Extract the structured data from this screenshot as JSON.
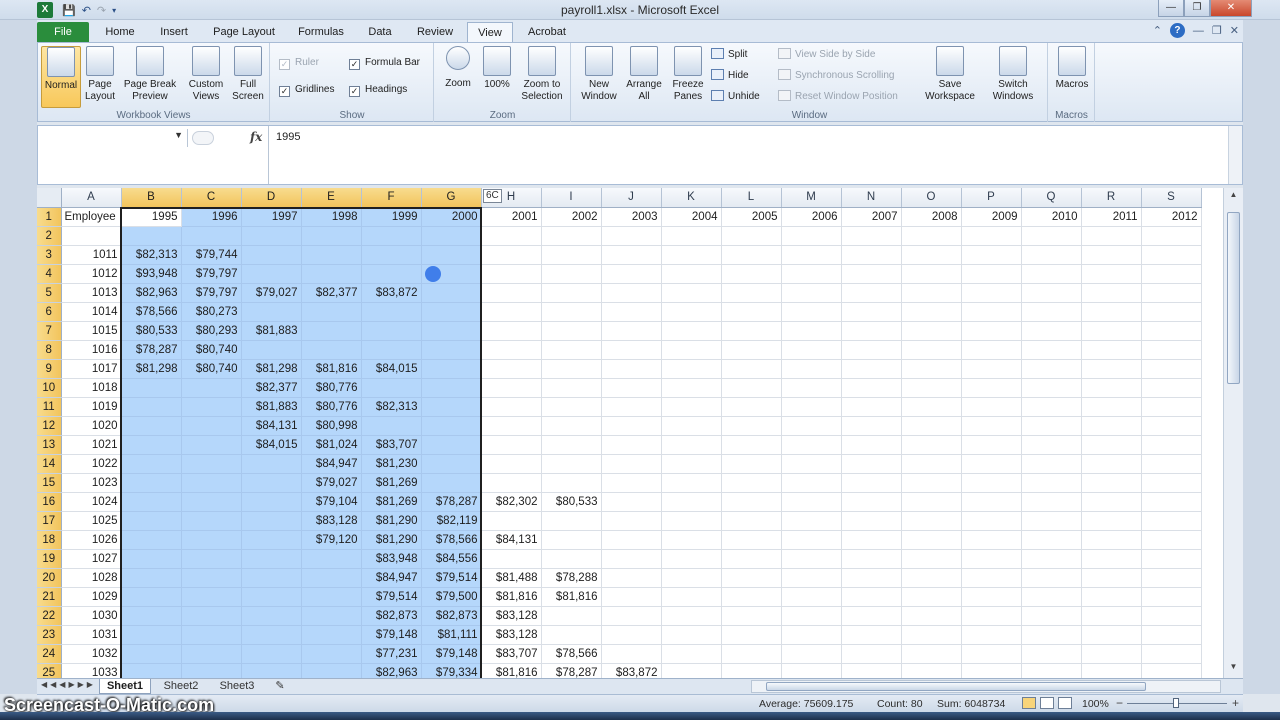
{
  "window": {
    "title": "payroll1.xlsx - Microsoft Excel",
    "app_icon": "X"
  },
  "ribbon_tabs": [
    {
      "label": "File",
      "state": "file"
    },
    {
      "label": "Home"
    },
    {
      "label": "Insert"
    },
    {
      "label": "Page Layout"
    },
    {
      "label": "Formulas"
    },
    {
      "label": "Data"
    },
    {
      "label": "Review"
    },
    {
      "label": "View",
      "state": "active"
    },
    {
      "label": "Acrobat"
    }
  ],
  "ribbon": {
    "workbook_views": {
      "label": "Workbook Views",
      "normal": "Normal",
      "page_layout": "Page Layout",
      "page_break_preview": "Page Break Preview",
      "custom_views": "Custom Views",
      "full_screen": "Full Screen"
    },
    "show": {
      "label": "Show",
      "ruler": "Ruler",
      "formula_bar": "Formula Bar",
      "gridlines": "Gridlines",
      "headings": "Headings"
    },
    "zoom": {
      "label": "Zoom",
      "zoom": "Zoom",
      "hundred": "100%",
      "zoom_to_selection": "Zoom to Selection"
    },
    "window": {
      "label": "Window",
      "new_window": "New Window",
      "arrange_all": "Arrange All",
      "freeze_panes": "Freeze Panes",
      "split": "Split",
      "hide": "Hide",
      "unhide": "Unhide",
      "view_side_by_side": "View Side by Side",
      "synchronous_scrolling": "Synchronous Scrolling",
      "reset_window_position": "Reset Window Position",
      "save_workspace": "Save Workspace",
      "switch_windows": "Switch Windows"
    },
    "macros": {
      "label": "Macros",
      "macros": "Macros"
    }
  },
  "formula_bar": {
    "name_box": "",
    "fx": "fx",
    "value": "1995"
  },
  "grid": {
    "columns": [
      "A",
      "B",
      "C",
      "D",
      "E",
      "F",
      "G",
      "H",
      "I",
      "J",
      "K",
      "L",
      "M",
      "N",
      "O",
      "P",
      "Q",
      "R",
      "S"
    ],
    "selected_columns": [
      "B",
      "C",
      "D",
      "E",
      "F",
      "G"
    ],
    "column_tooltip": "6C",
    "rows": [
      [
        "Employee",
        "1995",
        "1996",
        "1997",
        "1998",
        "1999",
        "2000",
        "2001",
        "2002",
        "2003",
        "2004",
        "2005",
        "2006",
        "2007",
        "2008",
        "2009",
        "2010",
        "2011",
        "2012"
      ],
      [
        "",
        "",
        "",
        "",
        "",
        "",
        "",
        "",
        "",
        "",
        "",
        "",
        "",
        "",
        "",
        "",
        "",
        "",
        ""
      ],
      [
        "1011",
        "$82,313",
        "$79,744",
        "",
        "",
        "",
        "",
        "",
        "",
        "",
        "",
        "",
        "",
        "",
        "",
        "",
        "",
        "",
        ""
      ],
      [
        "1012",
        "$93,948",
        "$79,797",
        "",
        "",
        "",
        "",
        "",
        "",
        "",
        "",
        "",
        "",
        "",
        "",
        "",
        "",
        "",
        ""
      ],
      [
        "1013",
        "$82,963",
        "$79,797",
        "$79,027",
        "$82,377",
        "$83,872",
        "",
        "",
        "",
        "",
        "",
        "",
        "",
        "",
        "",
        "",
        "",
        "",
        ""
      ],
      [
        "1014",
        "$78,566",
        "$80,273",
        "",
        "",
        "",
        "",
        "",
        "",
        "",
        "",
        "",
        "",
        "",
        "",
        "",
        "",
        "",
        ""
      ],
      [
        "1015",
        "$80,533",
        "$80,293",
        "$81,883",
        "",
        "",
        "",
        "",
        "",
        "",
        "",
        "",
        "",
        "",
        "",
        "",
        "",
        "",
        ""
      ],
      [
        "1016",
        "$78,287",
        "$80,740",
        "",
        "",
        "",
        "",
        "",
        "",
        "",
        "",
        "",
        "",
        "",
        "",
        "",
        "",
        "",
        ""
      ],
      [
        "1017",
        "$81,298",
        "$80,740",
        "$81,298",
        "$81,816",
        "$84,015",
        "",
        "",
        "",
        "",
        "",
        "",
        "",
        "",
        "",
        "",
        "",
        "",
        ""
      ],
      [
        "1018",
        "",
        "",
        "$82,377",
        "$80,776",
        "",
        "",
        "",
        "",
        "",
        "",
        "",
        "",
        "",
        "",
        "",
        "",
        "",
        ""
      ],
      [
        "1019",
        "",
        "",
        "$81,883",
        "$80,776",
        "$82,313",
        "",
        "",
        "",
        "",
        "",
        "",
        "",
        "",
        "",
        "",
        "",
        "",
        ""
      ],
      [
        "1020",
        "",
        "",
        "$84,131",
        "$80,998",
        "",
        "",
        "",
        "",
        "",
        "",
        "",
        "",
        "",
        "",
        "",
        "",
        "",
        ""
      ],
      [
        "1021",
        "",
        "",
        "$84,015",
        "$81,024",
        "$83,707",
        "",
        "",
        "",
        "",
        "",
        "",
        "",
        "",
        "",
        "",
        "",
        "",
        ""
      ],
      [
        "1022",
        "",
        "",
        "",
        "$84,947",
        "$81,230",
        "",
        "",
        "",
        "",
        "",
        "",
        "",
        "",
        "",
        "",
        "",
        "",
        ""
      ],
      [
        "1023",
        "",
        "",
        "",
        "$79,027",
        "$81,269",
        "",
        "",
        "",
        "",
        "",
        "",
        "",
        "",
        "",
        "",
        "",
        "",
        ""
      ],
      [
        "1024",
        "",
        "",
        "",
        "$79,104",
        "$81,269",
        "$78,287",
        "$82,302",
        "$80,533",
        "",
        "",
        "",
        "",
        "",
        "",
        "",
        "",
        "",
        ""
      ],
      [
        "1025",
        "",
        "",
        "",
        "$83,128",
        "$81,290",
        "$82,119",
        "",
        "",
        "",
        "",
        "",
        "",
        "",
        "",
        "",
        "",
        "",
        ""
      ],
      [
        "1026",
        "",
        "",
        "",
        "$79,120",
        "$81,290",
        "$78,566",
        "$84,131",
        "",
        "",
        "",
        "",
        "",
        "",
        "",
        "",
        "",
        "",
        ""
      ],
      [
        "1027",
        "",
        "",
        "",
        "",
        "$83,948",
        "$84,556",
        "",
        "",
        "",
        "",
        "",
        "",
        "",
        "",
        "",
        "",
        "",
        ""
      ],
      [
        "1028",
        "",
        "",
        "",
        "",
        "$84,947",
        "$79,514",
        "$81,488",
        "$78,288",
        "",
        "",
        "",
        "",
        "",
        "",
        "",
        "",
        "",
        ""
      ],
      [
        "1029",
        "",
        "",
        "",
        "",
        "$79,514",
        "$79,500",
        "$81,816",
        "$81,816",
        "",
        "",
        "",
        "",
        "",
        "",
        "",
        "",
        "",
        ""
      ],
      [
        "1030",
        "",
        "",
        "",
        "",
        "$82,873",
        "$82,873",
        "$83,128",
        "",
        "",
        "",
        "",
        "",
        "",
        "",
        "",
        "",
        "",
        ""
      ],
      [
        "1031",
        "",
        "",
        "",
        "",
        "$79,148",
        "$81,111",
        "$83,128",
        "",
        "",
        "",
        "",
        "",
        "",
        "",
        "",
        "",
        "",
        ""
      ],
      [
        "1032",
        "",
        "",
        "",
        "",
        "$77,231",
        "$79,148",
        "$83,707",
        "$78,566",
        "",
        "",
        "",
        "",
        "",
        "",
        "",
        "",
        "",
        ""
      ],
      [
        "1033",
        "",
        "",
        "",
        "",
        "$82,963",
        "$79,334",
        "$81,816",
        "$78,287",
        "$83,872",
        "",
        "",
        "",
        "",
        "",
        "",
        "",
        "",
        ""
      ]
    ]
  },
  "sheet_tabs": [
    "Sheet1",
    "Sheet2",
    "Sheet3"
  ],
  "active_sheet": "Sheet1",
  "status_bar": {
    "average": "Average: 75609.175",
    "count": "Count: 80",
    "sum": "Sum: 6048734",
    "zoom": "100%"
  },
  "watermark": "Screencast-O-Matic.com",
  "colors": {
    "selection_fill": "#b5d7fb",
    "selected_header": "#f2c45c",
    "file_tab": "#2a8d3c"
  }
}
